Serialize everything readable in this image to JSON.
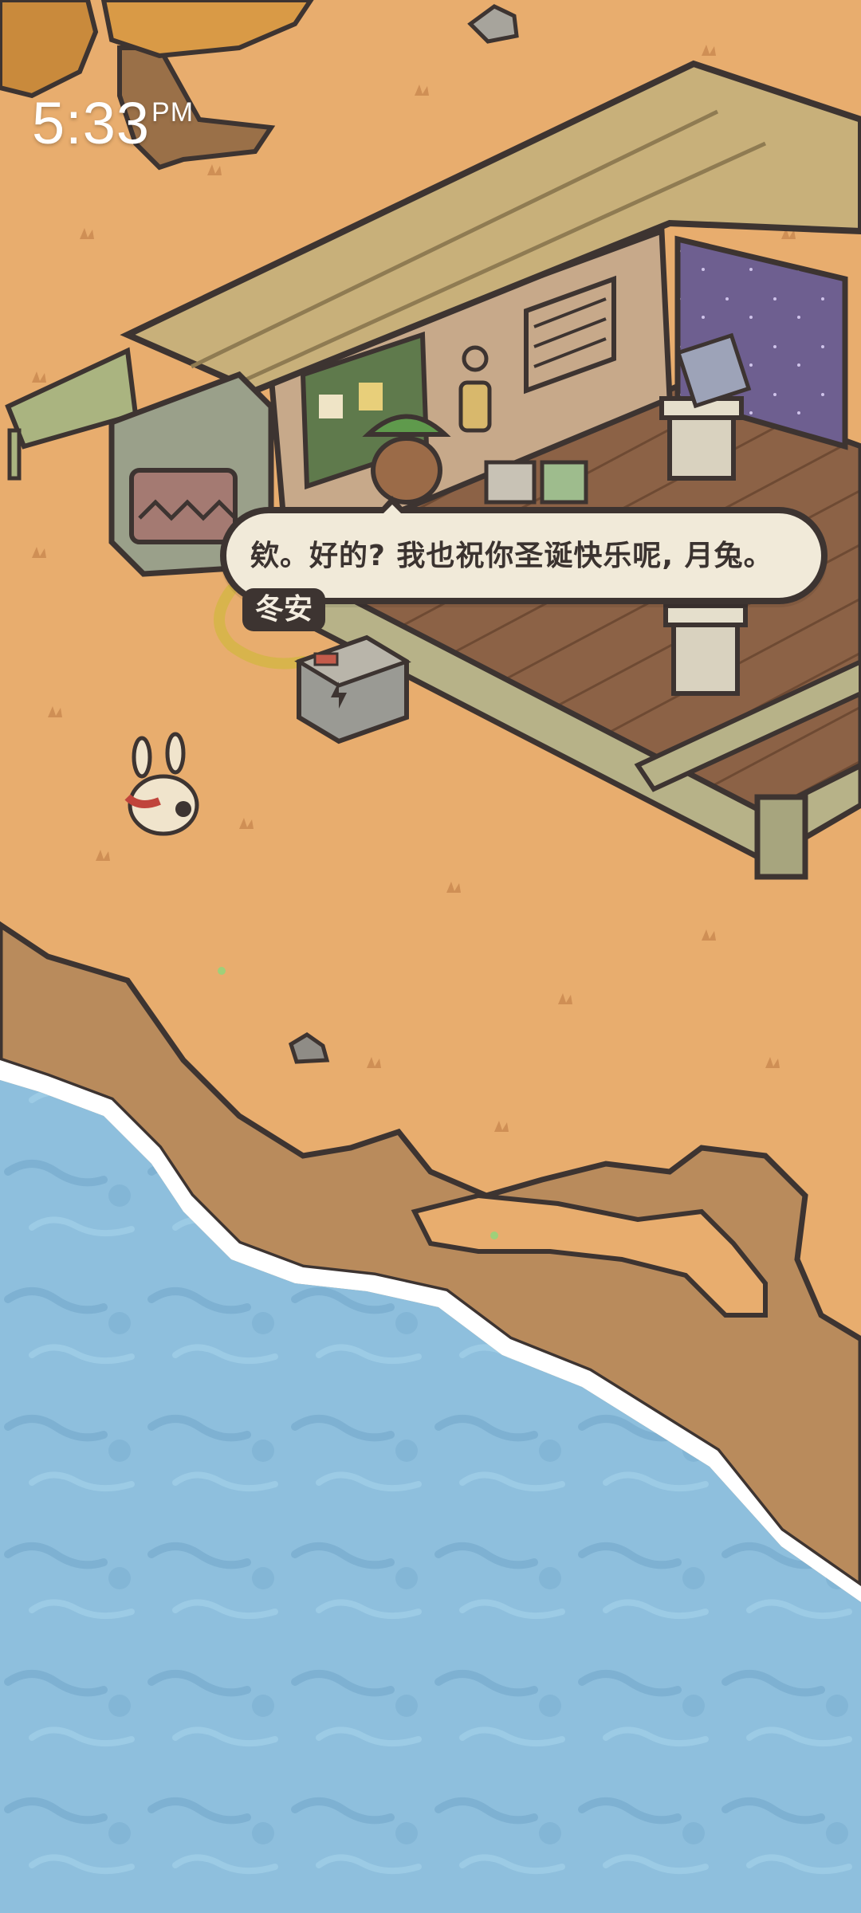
{
  "status_bar": {
    "time": "5:33",
    "ampm": "PM"
  },
  "dialogue": {
    "text": "欸。好的? 我也祝你圣诞快乐呢, 月兔。",
    "speaker": "冬安"
  },
  "colors": {
    "sand": "#e8ad6e",
    "water": "#8ebfdd",
    "cliff": "#b98b5c",
    "wood_roof": "#c8b07a",
    "floor": "#8a6145",
    "dialog_bg": "#f1ead9",
    "dialog_border": "#3d3431"
  }
}
